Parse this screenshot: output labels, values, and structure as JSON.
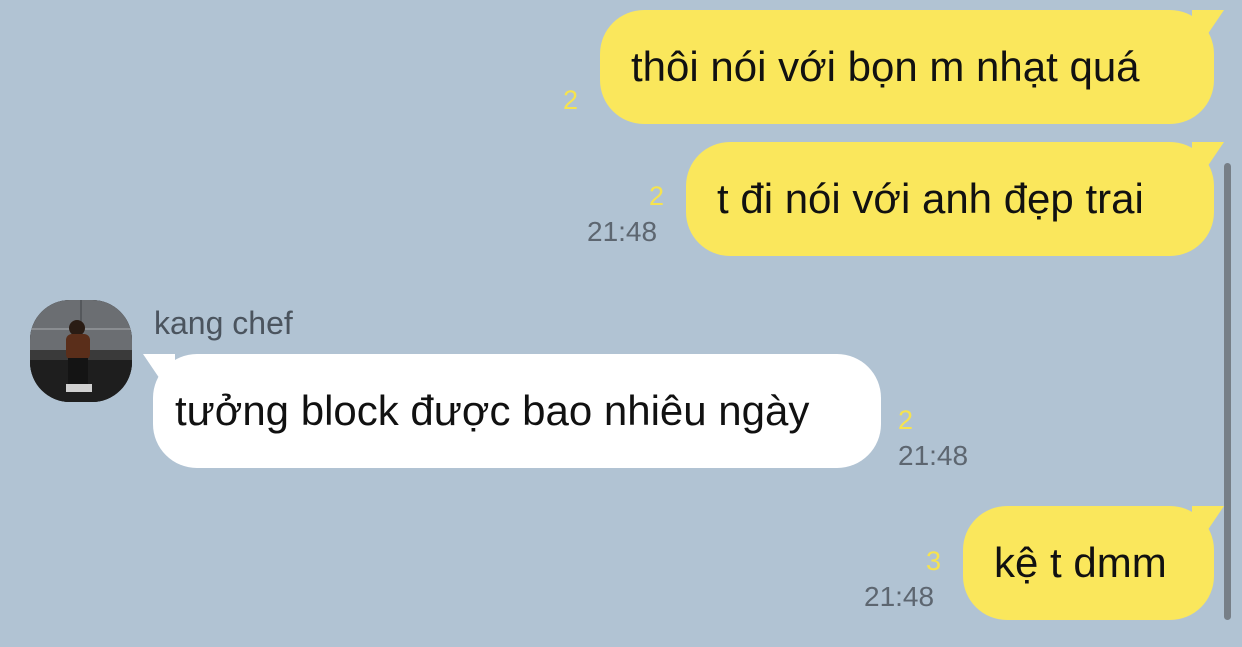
{
  "messages": [
    {
      "direction": "out",
      "text": "thôi nói với bọn m nhạt quá",
      "unread": "2",
      "time": ""
    },
    {
      "direction": "out",
      "text": "t đi nói với anh đẹp trai",
      "unread": "2",
      "time": "21:48"
    },
    {
      "direction": "in",
      "sender": "kang chef",
      "text": "tưởng block được bao nhiêu ngày",
      "unread": "2",
      "time": "21:48"
    },
    {
      "direction": "out",
      "text": "kệ t dmm",
      "unread": "3",
      "time": "21:48"
    }
  ],
  "colors": {
    "background": "#b1c3d3",
    "outgoing_bubble": "#fae75c",
    "incoming_bubble": "#ffffff",
    "unread_count": "#f6e34e",
    "timestamp": "#5d6670"
  }
}
